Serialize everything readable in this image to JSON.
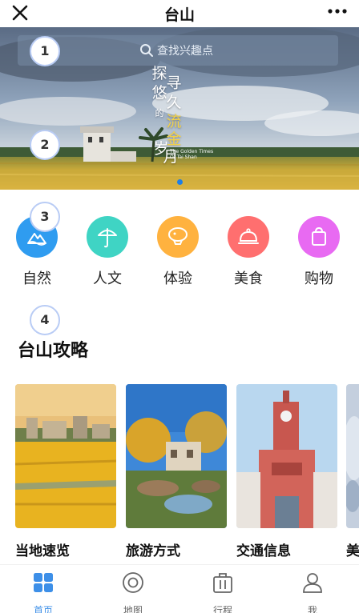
{
  "header": {
    "title": "台山"
  },
  "search": {
    "placeholder": "查找兴趣点"
  },
  "banner": {
    "poem_col1": [
      "探",
      "悠",
      "的"
    ],
    "poem_col2": [
      "寻",
      "久"
    ],
    "poem_gold": [
      "流",
      "金"
    ],
    "poem_bottom": [
      "岁",
      "月"
    ],
    "english_tag": [
      "The Golden Times",
      "Of Tai Shan"
    ]
  },
  "markers": [
    "1",
    "2",
    "3",
    "4"
  ],
  "categories": [
    {
      "label": "自然",
      "icon": "mountain-icon",
      "color": "#2f9cf0"
    },
    {
      "label": "人文",
      "icon": "umbrella-icon",
      "color": "#3fd4c4"
    },
    {
      "label": "体验",
      "icon": "balloon-icon",
      "color": "#ffb23f"
    },
    {
      "label": "美食",
      "icon": "cloche-icon",
      "color": "#ff6f6f"
    },
    {
      "label": "购物",
      "icon": "shopping-bag-icon",
      "color": "#e86af2"
    }
  ],
  "section": {
    "title": "台山攻略"
  },
  "cards": [
    {
      "label": "当地速览"
    },
    {
      "label": "旅游方式"
    },
    {
      "label": "交通信息"
    },
    {
      "label": "美"
    }
  ],
  "tabs": [
    {
      "label": "首页",
      "icon": "home-grid-icon",
      "active": true
    },
    {
      "label": "地图",
      "icon": "map-target-icon",
      "active": false
    },
    {
      "label": "行程",
      "icon": "luggage-icon",
      "active": false
    },
    {
      "label": "我",
      "icon": "person-icon",
      "active": false
    }
  ],
  "colors": {
    "accent": "#3d8fe8",
    "indicator": "#1e7fe6"
  }
}
